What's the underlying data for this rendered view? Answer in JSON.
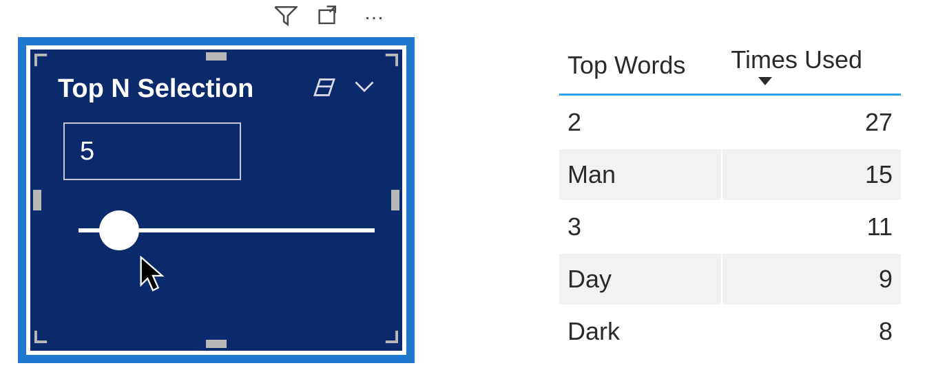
{
  "colors": {
    "selection_border": "#1f77d0",
    "slicer_bg": "#0a2a6b",
    "header_rule": "#2aa0e6",
    "alt_row": "#f2f2f2"
  },
  "visual_header": {
    "icons": [
      "filter-icon",
      "focus-mode-icon",
      "more-icon"
    ]
  },
  "slicer": {
    "title": "Top N Selection",
    "value": "5",
    "range": {
      "min": 1,
      "max": 50,
      "thumb_fraction": 0.08
    },
    "icons": [
      "eraser-icon",
      "chevron-down-icon"
    ]
  },
  "table": {
    "columns": [
      {
        "label": "Top Words",
        "sort": null
      },
      {
        "label": "Times Used",
        "sort": "desc"
      }
    ],
    "rows": [
      {
        "word": "2",
        "count": "27"
      },
      {
        "word": "Man",
        "count": "15"
      },
      {
        "word": "3",
        "count": "11"
      },
      {
        "word": "Day",
        "count": "9"
      },
      {
        "word": "Dark",
        "count": "8"
      }
    ]
  }
}
